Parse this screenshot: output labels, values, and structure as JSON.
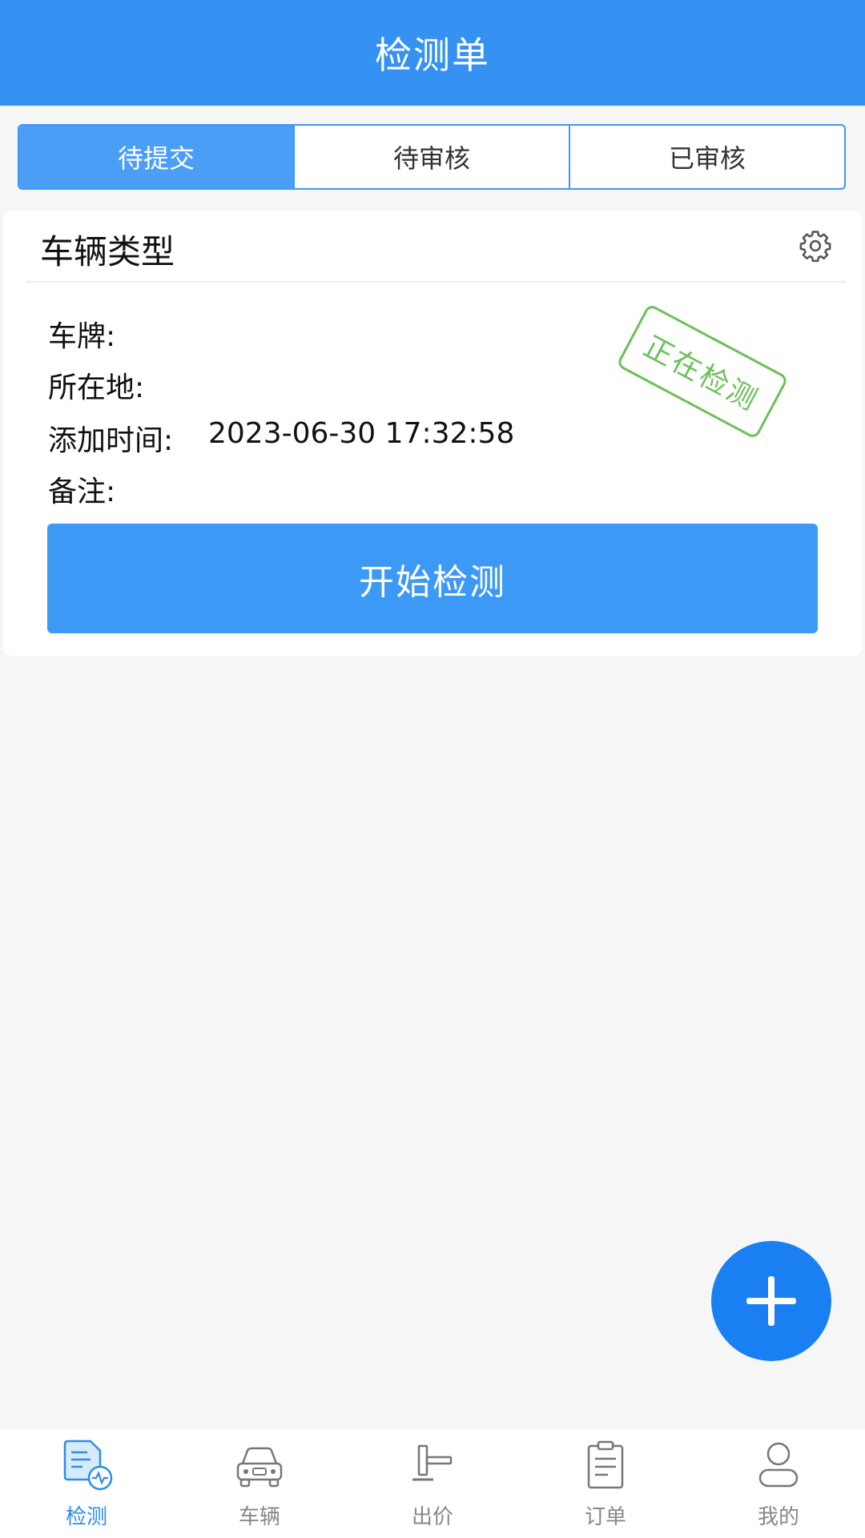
{
  "header": {
    "title": "检测单"
  },
  "tabs": [
    {
      "label": "待提交",
      "active": true
    },
    {
      "label": "待审核",
      "active": false
    },
    {
      "label": "已审核",
      "active": false
    }
  ],
  "card": {
    "title": "车辆类型",
    "settings_icon": "gear-icon",
    "fields": [
      {
        "label": "车牌:",
        "value": ""
      },
      {
        "label": "所在地:",
        "value": ""
      },
      {
        "label": "添加时间:",
        "value": "2023-06-30 17:32:58"
      },
      {
        "label": "备注:",
        "value": ""
      }
    ],
    "stamp": "正在检测",
    "start_button": "开始检测"
  },
  "fab": {
    "icon": "plus-icon"
  },
  "bottom_nav": [
    {
      "label": "检测",
      "icon": "inspection-icon",
      "active": true
    },
    {
      "label": "车辆",
      "icon": "car-icon",
      "active": false
    },
    {
      "label": "出价",
      "icon": "gavel-icon",
      "active": false
    },
    {
      "label": "订单",
      "icon": "clipboard-icon",
      "active": false
    },
    {
      "label": "我的",
      "icon": "user-icon",
      "active": false
    }
  ],
  "colors": {
    "primary": "#3592f3",
    "stamp": "#6cc05a",
    "fab": "#1a7ff2"
  }
}
